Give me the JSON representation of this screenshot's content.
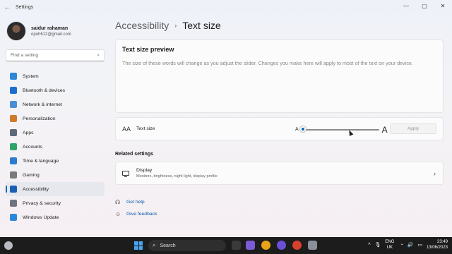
{
  "window": {
    "title": "Settings",
    "back_icon": "←",
    "minimize": "—",
    "maximize": "▢",
    "close": "✕"
  },
  "user": {
    "name": "saidur rahaman",
    "email": "opuh612@gmail.com"
  },
  "search": {
    "placeholder": "Find a setting",
    "icon": "⌕"
  },
  "sidebar": {
    "items": [
      {
        "label": "System",
        "icon": "system-icon",
        "color": "#2b88d8"
      },
      {
        "label": "Bluetooth & devices",
        "icon": "bluetooth-icon",
        "color": "#1c6fcf"
      },
      {
        "label": "Network & internet",
        "icon": "network-icon",
        "color": "#4a8fd6"
      },
      {
        "label": "Personalization",
        "icon": "brush-icon",
        "color": "#d07a2e"
      },
      {
        "label": "Apps",
        "icon": "apps-icon",
        "color": "#5c6a7a"
      },
      {
        "label": "Accounts",
        "icon": "accounts-icon",
        "color": "#2ea36b"
      },
      {
        "label": "Time & language",
        "icon": "time-icon",
        "color": "#2b7bd2"
      },
      {
        "label": "Gaming",
        "icon": "gaming-icon",
        "color": "#7a7a7a"
      },
      {
        "label": "Accessibility",
        "icon": "accessibility-icon",
        "color": "#1a5fb4",
        "active": true
      },
      {
        "label": "Privacy & security",
        "icon": "shield-icon",
        "color": "#6d7580"
      },
      {
        "label": "Windows Update",
        "icon": "update-icon",
        "color": "#2b88d8"
      }
    ]
  },
  "breadcrumb": {
    "parent": "Accessibility",
    "separator": "›",
    "current": "Text size"
  },
  "preview": {
    "title": "Text size preview",
    "body": "The size of these words will change as you adjust the slider. Changes you make here will apply to most of the text on your device."
  },
  "text_size": {
    "icon": "AA",
    "label": "Text size",
    "small_a": "A",
    "large_a": "A",
    "slider_fraction": 0.0,
    "apply_label": "Apply"
  },
  "related": {
    "heading": "Related settings",
    "display_title": "Display",
    "display_subtitle": "Monitors, brightness, night light, display profile",
    "chevron": "›"
  },
  "links": {
    "help": "Get help",
    "feedback": "Give feedback",
    "help_icon": "☊",
    "feedback_icon": "☺"
  },
  "taskbar": {
    "search_label": "Search",
    "search_icon": "⌕",
    "lang_top": "ENG",
    "lang_bottom": "UK",
    "time": "23:49",
    "date": "13/06/2023",
    "tray_up": "^",
    "mic": "🎙",
    "wifi": "◔",
    "volume": "🔊",
    "battery": "▭"
  }
}
